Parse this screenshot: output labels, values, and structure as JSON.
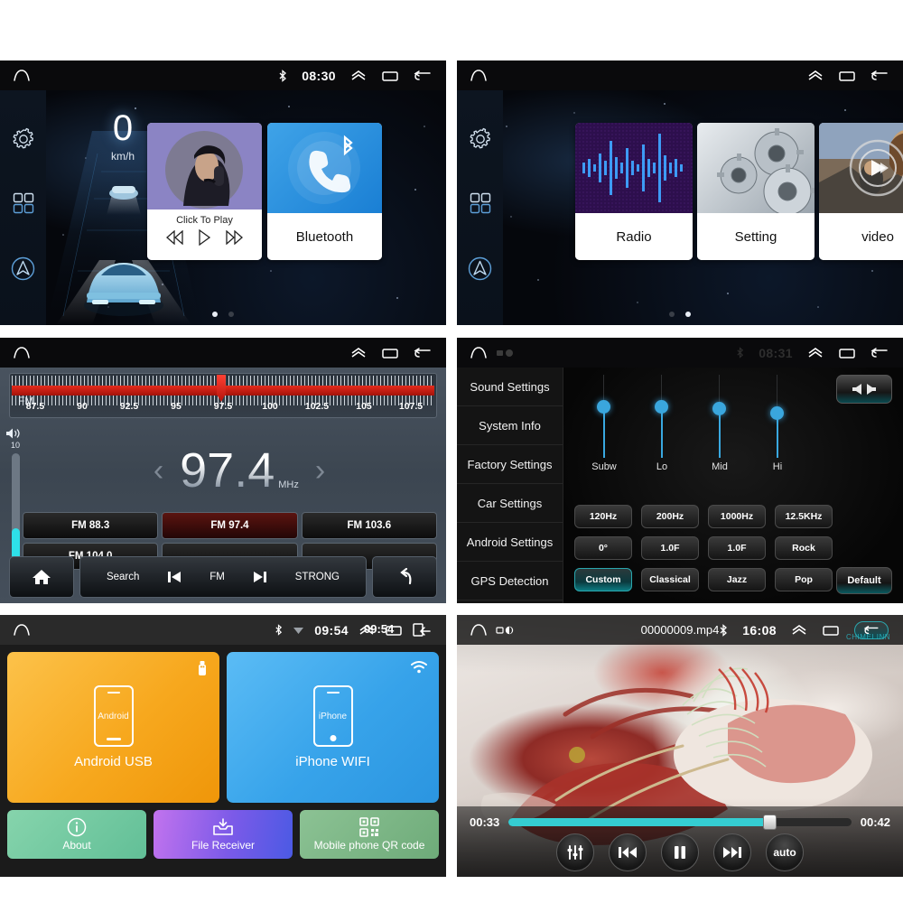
{
  "panels": {
    "home1": {
      "name": "Home Screen 1",
      "statusbar": {
        "time": "08:30",
        "bluetooth_icon": "bluetooth-icon"
      },
      "dock": [
        {
          "icon": "gear-icon",
          "name": "settings"
        },
        {
          "icon": "grid-icon",
          "name": "apps"
        },
        {
          "icon": "navigation-icon",
          "name": "navigation"
        }
      ],
      "speedometer": {
        "value": "0",
        "unit": "km/h"
      },
      "tiles": [
        {
          "caption": "Click To Play",
          "icon": "music-artist-thumb",
          "controls": [
            "prev-icon",
            "play-icon",
            "next-icon"
          ]
        },
        {
          "caption": "Bluetooth",
          "icon": "bluetooth-phone-icon"
        }
      ],
      "page_dots": {
        "count": 2,
        "active": 0
      }
    },
    "home2": {
      "name": "Home Screen 2",
      "statusbar": {
        "time": ""
      },
      "tiles": [
        {
          "caption": "Radio",
          "icon": "waveform-thumb"
        },
        {
          "caption": "Setting",
          "icon": "gears-thumb"
        },
        {
          "caption": "video",
          "icon": "movie-thumb"
        }
      ],
      "page_dots": {
        "count": 2,
        "active": 1
      }
    },
    "radio": {
      "name": "FM Radio",
      "statusbar": {
        "time": ""
      },
      "dial": {
        "ticks": [
          "87.5",
          "90",
          "92.5",
          "95",
          "97.5",
          "100",
          "102.5",
          "105",
          "107.5"
        ],
        "needle_percent": 48.5,
        "band_color": "#d62718"
      },
      "volume": {
        "level": "10",
        "icon": "volume-icon",
        "fill_percent": 30
      },
      "band": "FM",
      "frequency": "97.4",
      "frequency_unit": "MHz",
      "prev_arrow": "chevron-left-icon",
      "next_arrow": "chevron-right-icon",
      "presets": [
        [
          "FM 88.3",
          "FM 97.4",
          "FM 103.6"
        ],
        [
          "FM 104.0",
          "",
          ""
        ]
      ],
      "active_preset": "FM 97.4",
      "bottombar": {
        "home_icon": "home-icon",
        "search_label": "Search",
        "prev_icon": "skip-prev-icon",
        "band_label": "FM",
        "next_icon": "skip-next-icon",
        "strong_label": "STRONG",
        "back_icon": "back-arrow-icon"
      }
    },
    "settings": {
      "name": "Sound Settings",
      "statusbar": {
        "time": "08:31"
      },
      "menu": [
        "Sound Settings",
        "System Info",
        "Factory Settings",
        "Car Settings",
        "Android Settings",
        "GPS Detection"
      ],
      "active_menu": "Sound Settings",
      "sliders": [
        {
          "label": "Subw",
          "percent": 62
        },
        {
          "label": "Lo",
          "percent": 62
        },
        {
          "label": "Mid",
          "percent": 60
        },
        {
          "label": "Hi",
          "percent": 54
        }
      ],
      "buttons": [
        [
          "120Hz",
          "200Hz",
          "1000Hz",
          "12.5KHz"
        ],
        [
          "0°",
          "1.0F",
          "1.0F",
          "Rock"
        ],
        [
          "Custom",
          "Classical",
          "Jazz",
          "Pop"
        ]
      ],
      "selected_button": "Custom",
      "balance_button": {
        "icon": "balance-speakers-icon"
      },
      "default_button": {
        "label": "Default"
      }
    },
    "mirror": {
      "name": "Mirror Link",
      "statusbar": {
        "time": "09:54",
        "overlay_time": "09:54",
        "bluetooth_icon": "bluetooth-icon",
        "wifi_icon": "wifi-icon"
      },
      "cards": [
        {
          "label": "Android USB",
          "phone_text": "Android",
          "corner_icon": "usb-icon",
          "color": "#f5a623"
        },
        {
          "label": "iPhone WIFI",
          "phone_text": "iPhone",
          "corner_icon": "wifi-icon",
          "color": "#3aa7ea"
        }
      ],
      "small_buttons": [
        {
          "label": "About",
          "icon": "info-icon",
          "color": "#72c9a0"
        },
        {
          "label": "File Receiver",
          "icon": "inbox-download-icon",
          "color": "#9a5fe0"
        },
        {
          "label": "Mobile phone QR code",
          "icon": "qr-code-icon",
          "color": "#79b583"
        }
      ]
    },
    "video": {
      "name": "Video Player",
      "statusbar": {
        "title": "00000009.mp4",
        "time": "16:08",
        "bluetooth_icon": "bluetooth-icon"
      },
      "watermark": "CHIMEI INN",
      "elapsed": "00:33",
      "duration": "00:42",
      "progress_percent": 76,
      "controls": [
        {
          "icon": "equalizer-icon",
          "name": "equalizer"
        },
        {
          "icon": "skip-prev-icon",
          "name": "previous"
        },
        {
          "icon": "pause-icon",
          "name": "pause"
        },
        {
          "icon": "skip-next-icon",
          "name": "next"
        },
        {
          "icon": "auto-label",
          "name": "auto",
          "label": "auto"
        }
      ]
    }
  },
  "colors": {
    "accent_cyan": "#35cdd2",
    "accent_blue": "#3aa6dd",
    "radio_red": "#d62718",
    "tile_purple": "#8b84c4",
    "tile_blue": "#2b93e0"
  }
}
